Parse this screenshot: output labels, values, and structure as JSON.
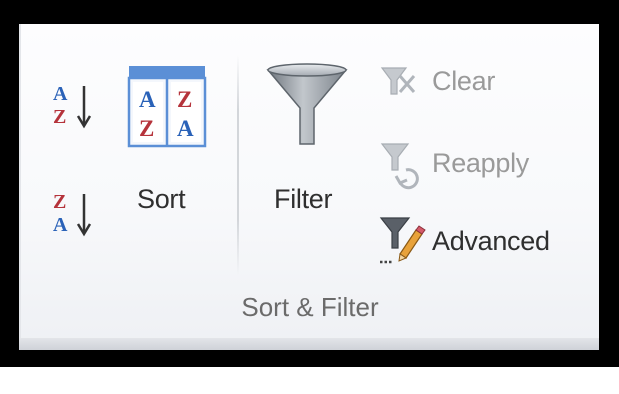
{
  "ribbon": {
    "group_label": "Sort & Filter",
    "commands": {
      "sort_az": {
        "icon": "sort-ascending-icon",
        "glyph_top": "A",
        "glyph_bottom": "Z"
      },
      "sort_za": {
        "icon": "sort-descending-icon",
        "glyph_top": "Z",
        "glyph_bottom": "A"
      },
      "sort": {
        "label": "Sort",
        "icon": "sort-dialog-icon",
        "glyphs": [
          "A",
          "Z",
          "Z",
          "A"
        ]
      },
      "filter": {
        "label": "Filter",
        "icon": "funnel-icon"
      },
      "clear": {
        "label": "Clear",
        "icon": "clear-filter-icon",
        "enabled": false
      },
      "reapply": {
        "label": "Reapply",
        "icon": "reapply-filter-icon",
        "enabled": false
      },
      "advanced": {
        "label": "Advanced",
        "icon": "advanced-filter-icon",
        "enabled": true
      }
    }
  },
  "colors": {
    "blue_letter": "#2a62b8",
    "red_letter": "#b5333b",
    "funnel": "#8d949c",
    "disabled_text": "#9a9a9a",
    "text": "#2f2f2f"
  }
}
